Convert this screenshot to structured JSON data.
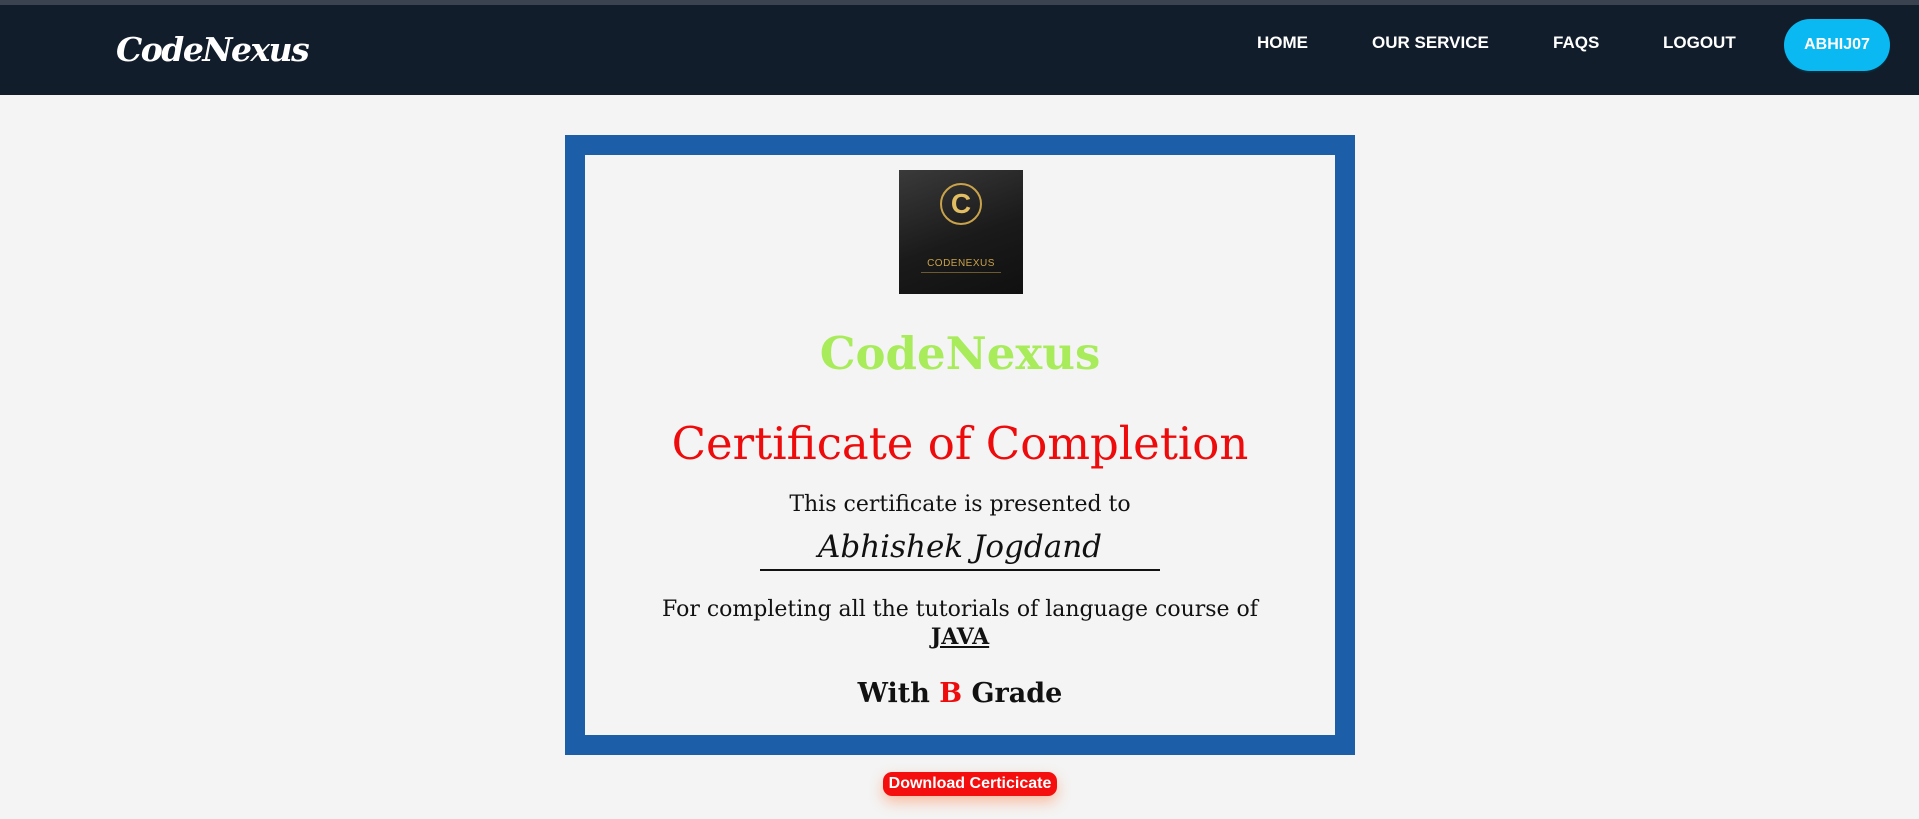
{
  "navbar": {
    "brand": "CodeNexus",
    "links": [
      "HOME",
      "OUR SERVICE",
      "FAQS",
      "LOGOUT"
    ],
    "user": "ABHIJ07"
  },
  "certificate": {
    "logo_text": "CODENEXUS",
    "logo_letter": "C",
    "brand": "CodeNexus",
    "title": "Certificate of Completion",
    "presented_to": "This certificate is presented to",
    "recipient": "Abhishek Jogdand",
    "for_text": "For completing all the tutorials of language course of",
    "course": "JAVA",
    "grade_prefix": "With",
    "grade": "B",
    "grade_suffix": "Grade"
  },
  "download_button": "Download Certicicate",
  "colors": {
    "navbar": "#121d2c",
    "frame": "#1c5ea8",
    "brand_green": "#a8ec5c",
    "title_red": "#ee0b0b",
    "user_button": "#0ab8f2"
  }
}
